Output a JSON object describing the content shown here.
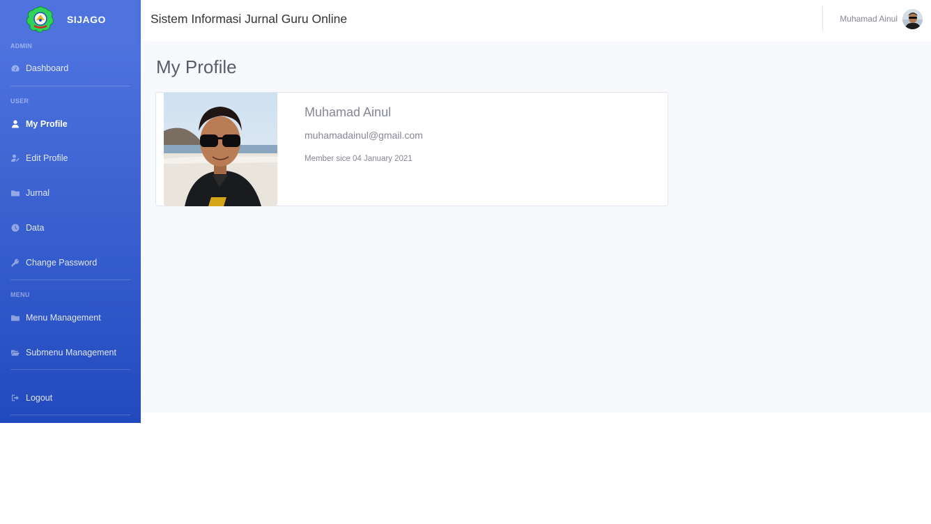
{
  "brand": {
    "name": "SIJAGO"
  },
  "sidebar": {
    "headings": {
      "admin": "ADMIN",
      "user": "USER",
      "menu": "MENU"
    },
    "items": [
      {
        "label": "Dashboard",
        "icon": "dashboard-icon"
      },
      {
        "label": "My Profile",
        "icon": "user-icon",
        "active": true
      },
      {
        "label": "Edit Profile",
        "icon": "user-edit-icon"
      },
      {
        "label": "Jurnal",
        "icon": "folder-icon"
      },
      {
        "label": "Data",
        "icon": "clock-icon"
      },
      {
        "label": "Change Password",
        "icon": "key-icon"
      },
      {
        "label": "Menu Management",
        "icon": "folder-icon"
      },
      {
        "label": "Submenu Management",
        "icon": "folder-open-icon"
      },
      {
        "label": "Logout",
        "icon": "sign-out-icon"
      }
    ]
  },
  "topbar": {
    "title": "Sistem Informasi Jurnal Guru Online",
    "user_name": "Muhamad Ainul"
  },
  "page": {
    "title": "My Profile"
  },
  "profile": {
    "name": "Muhamad Ainul",
    "email": "muhamadainul@gmail.com",
    "member_since": "Member sice 04 January 2021"
  },
  "colors": {
    "sidebar_top": "#4e73df",
    "sidebar_bottom": "#224abe",
    "content_bg": "#f8f9fc",
    "text_muted": "#858796"
  }
}
